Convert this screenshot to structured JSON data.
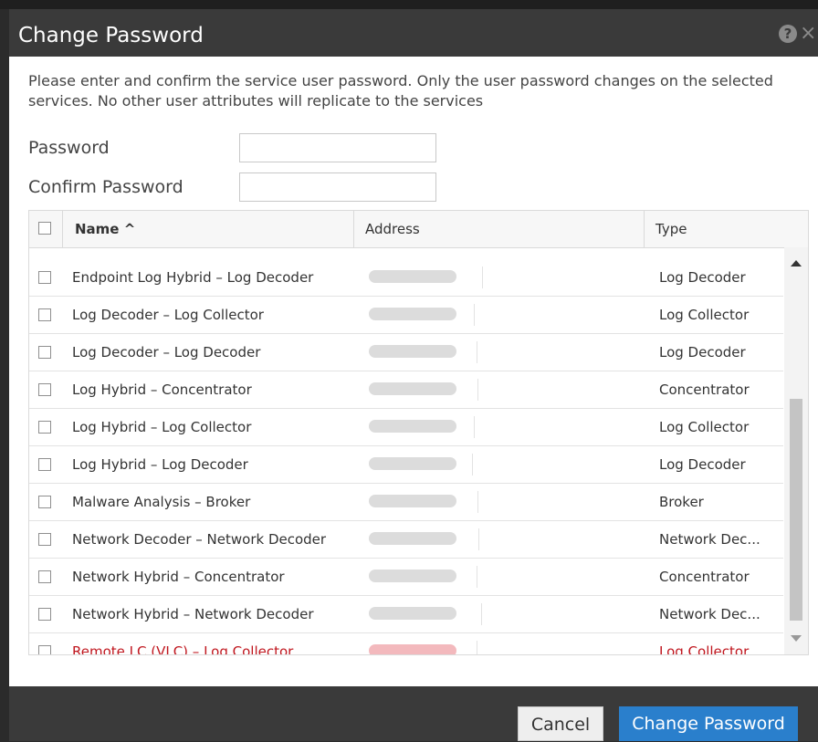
{
  "dialog": {
    "title": "Change Password",
    "description": "Please enter and confirm the service user password. Only the user password changes on the selected services. No other user attributes will replicate to the services",
    "password_label": "Password",
    "confirm_label": "Confirm Password",
    "password_value": "",
    "confirm_value": ""
  },
  "table": {
    "columns": {
      "name": "Name ^",
      "address": "Address",
      "type": "Type"
    },
    "rows": [
      {
        "name": "Endpoint Log Hybrid – Log Decoder",
        "address": "",
        "type": "Log Decoder",
        "status": "normal"
      },
      {
        "name": "Log Decoder – Log Collector",
        "address": "",
        "type": "Log Collector",
        "status": "normal"
      },
      {
        "name": "Log Decoder – Log Decoder",
        "address": "",
        "type": "Log Decoder",
        "status": "normal"
      },
      {
        "name": "Log Hybrid – Concentrator",
        "address": "",
        "type": "Concentrator",
        "status": "normal"
      },
      {
        "name": "Log Hybrid – Log Collector",
        "address": "",
        "type": "Log Collector",
        "status": "normal"
      },
      {
        "name": "Log Hybrid – Log Decoder",
        "address": "",
        "type": "Log Decoder",
        "status": "normal"
      },
      {
        "name": "Malware Analysis – Broker",
        "address": "",
        "type": "Broker",
        "status": "normal"
      },
      {
        "name": "Network Decoder – Network Decoder",
        "address": "",
        "type": "Network Dec...",
        "status": "normal"
      },
      {
        "name": "Network Hybrid – Concentrator",
        "address": "",
        "type": "Concentrator",
        "status": "normal"
      },
      {
        "name": "Network Hybrid – Network Decoder",
        "address": "",
        "type": "Network Dec...",
        "status": "normal"
      },
      {
        "name": "Remote LC (VLC) – Log Collector",
        "address": "",
        "type": "Log Collector",
        "status": "error"
      }
    ]
  },
  "buttons": {
    "cancel": "Cancel",
    "submit": "Change Password"
  },
  "colors": {
    "primary": "#2a7fcc",
    "error": "#c0171f",
    "titlebar": "#3a3a3a"
  },
  "icons": {
    "help": "help-icon",
    "close": "close-icon"
  }
}
